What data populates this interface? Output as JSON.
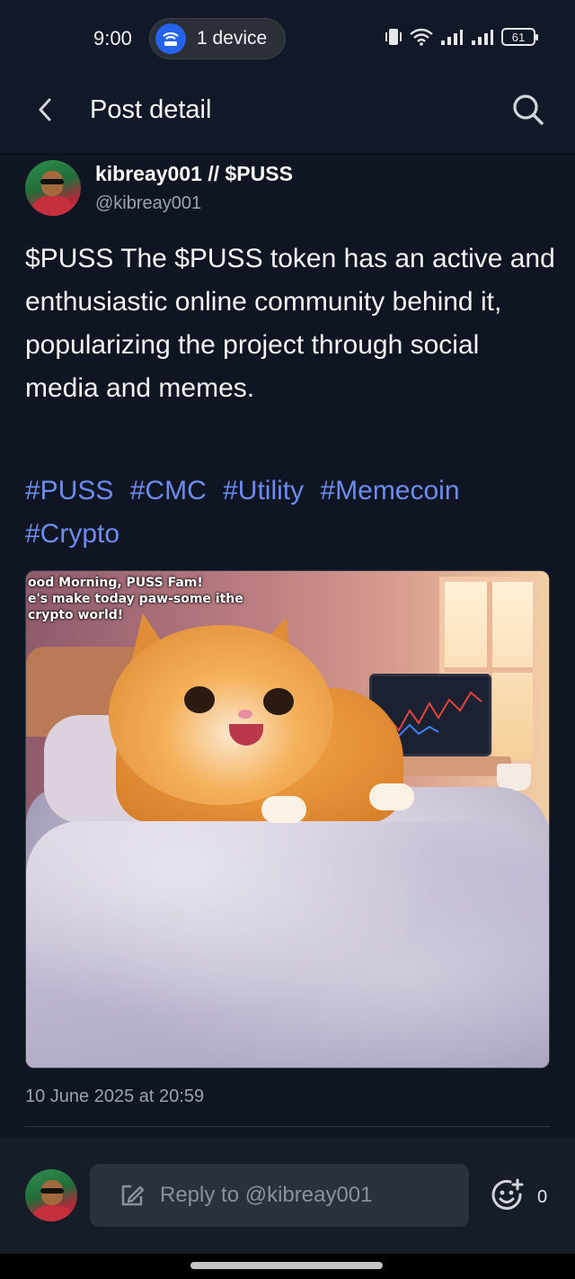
{
  "status_bar": {
    "time": "9:00",
    "device_pill_label": "1 device",
    "battery": "61"
  },
  "header": {
    "title": "Post detail",
    "back_icon": "chevron-left-icon",
    "search_icon": "search-icon"
  },
  "post": {
    "author_name": "kibreay001 // $PUSS",
    "author_handle": "@kibreay001",
    "text": "$PUSS The $PUSS token has an active and enthusiastic online community behind it, popularizing the project through social media and memes.",
    "hashtags": [
      "#PUSS",
      "#CMC",
      "#Utility",
      "#Memecoin",
      "#Crypto"
    ],
    "image_caption_lines": [
      "ood Morning, PUSS  Fam!",
      "e's make today paw-some ithe",
      "crypto world!"
    ],
    "date": "10 June 2025 at 20:59"
  },
  "reply_bar": {
    "placeholder": "Reply to @kibreay001",
    "emoji_count": "0"
  },
  "colors": {
    "background": "#0f1522",
    "hashtag": "#6d8cf0",
    "accent": "#2563eb"
  }
}
